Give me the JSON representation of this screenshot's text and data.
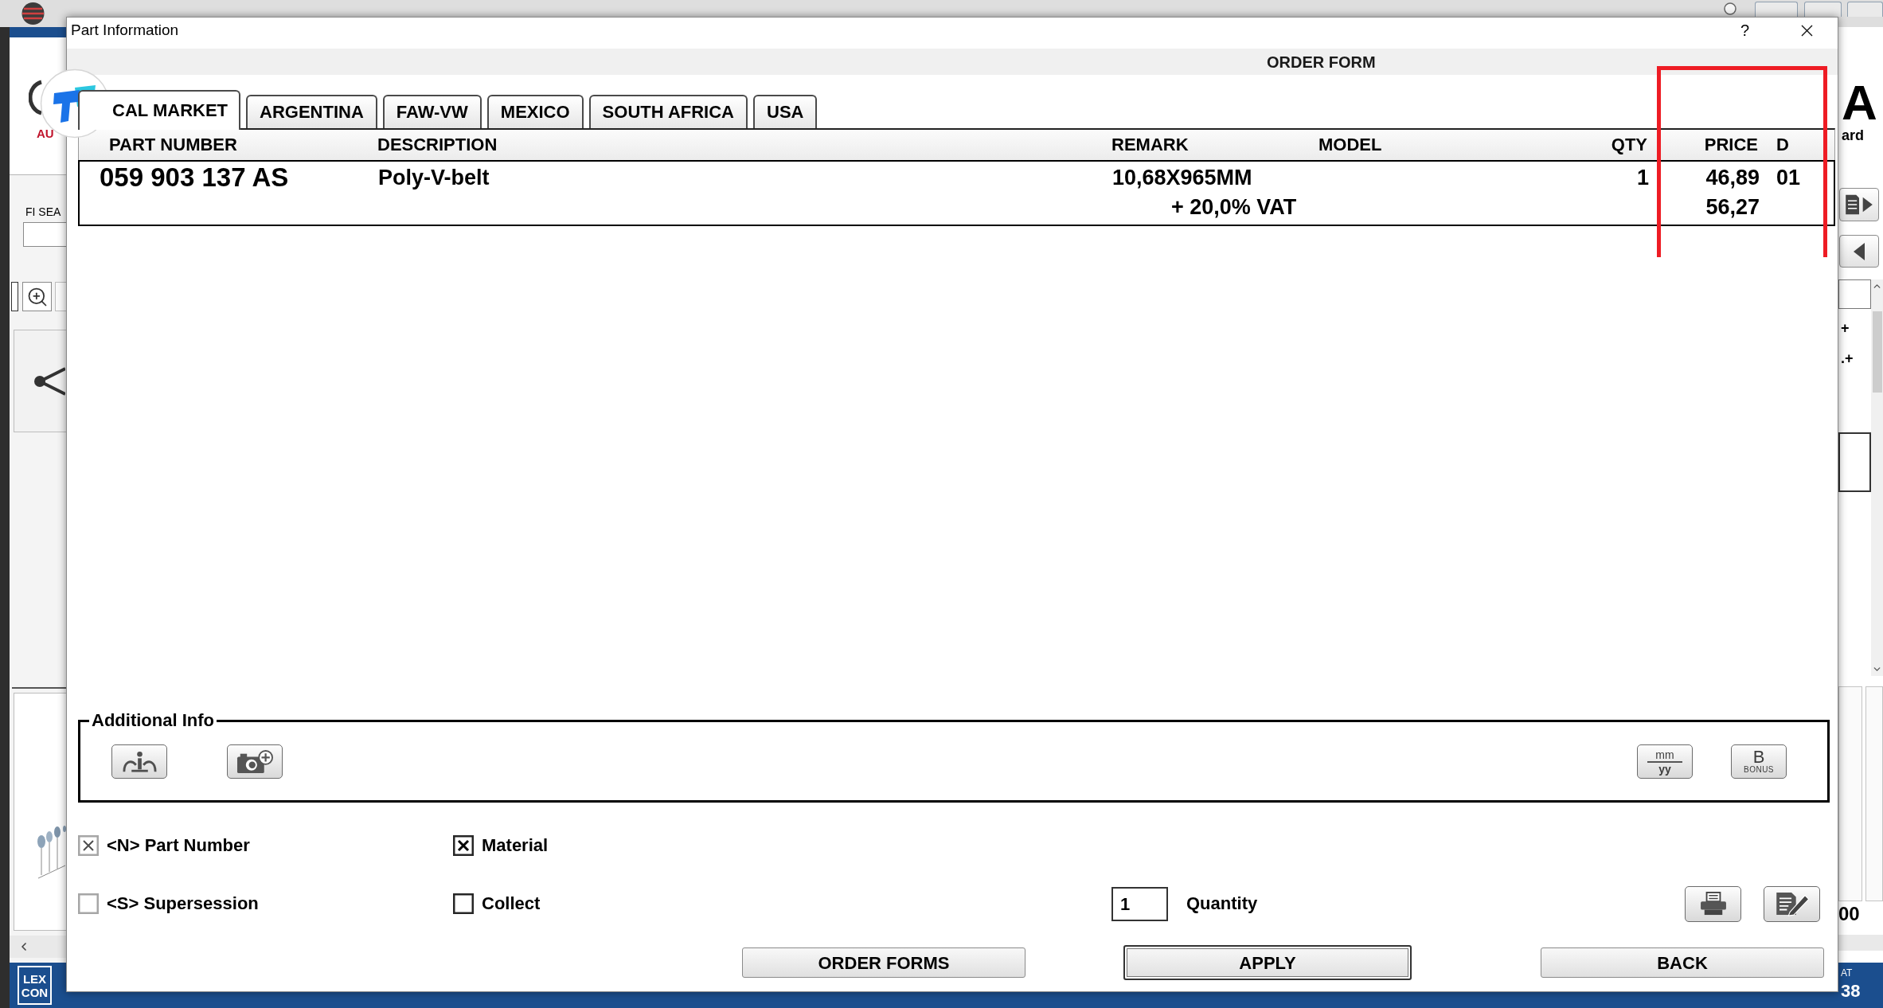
{
  "background_window": {
    "left_panel": {
      "logo_text": "AU",
      "search_label": "FI SEA",
      "footer_logo": [
        "LEX",
        "CON"
      ]
    },
    "right_panel": {
      "logo_letter": "A",
      "logo_caption": "ard",
      "marks": [
        "+",
        ".+"
      ],
      "footer_value": "00",
      "status_caption": "AT",
      "status_value": "38"
    }
  },
  "dialog": {
    "title": "Part Information",
    "help": "?",
    "header": "ORDER FORM",
    "tabs": [
      {
        "label": "CAL MARKET",
        "selected": true
      },
      {
        "label": "ARGENTINA",
        "selected": false
      },
      {
        "label": "FAW-VW",
        "selected": false
      },
      {
        "label": "MEXICO",
        "selected": false
      },
      {
        "label": "SOUTH AFRICA",
        "selected": false
      },
      {
        "label": "USA",
        "selected": false
      }
    ],
    "table": {
      "columns": [
        "PART NUMBER",
        "DESCRIPTION",
        "REMARK",
        "MODEL",
        "QTY",
        "PRICE",
        "D"
      ],
      "rows": [
        {
          "part_number": "059 903 137 AS",
          "description": "Poly-V-belt",
          "remark": "10,68X965MM",
          "qty": "1",
          "price": "46,89",
          "d": "01",
          "vat_note": "+ 20,0% VAT",
          "price_with_vat": "56,27"
        }
      ]
    },
    "additional_info": {
      "title": "Additional Info",
      "left_tools": [
        {
          "kind": "info"
        },
        {
          "kind": "camera"
        }
      ],
      "right_tools": [
        {
          "kind": "date",
          "top": "mm",
          "bottom": "yy"
        },
        {
          "kind": "bonus",
          "letter": "B",
          "caption": "BONUS"
        }
      ]
    },
    "options": [
      {
        "label": "<N> Part Number",
        "checked": true,
        "disabled": true
      },
      {
        "label": "Material",
        "checked": true,
        "disabled": false
      },
      {
        "label": "<S> Supersession",
        "checked": false,
        "disabled": true
      },
      {
        "label": "Collect",
        "checked": false,
        "disabled": false
      }
    ],
    "quantity": {
      "label": "Quantity",
      "value": "1"
    },
    "actions": [
      {
        "kind": "print"
      },
      {
        "kind": "edit"
      }
    ],
    "buttons": [
      {
        "label": "ORDER FORMS",
        "default": false
      },
      {
        "label": "APPLY",
        "default": true
      },
      {
        "label": "BACK",
        "default": false
      }
    ]
  }
}
